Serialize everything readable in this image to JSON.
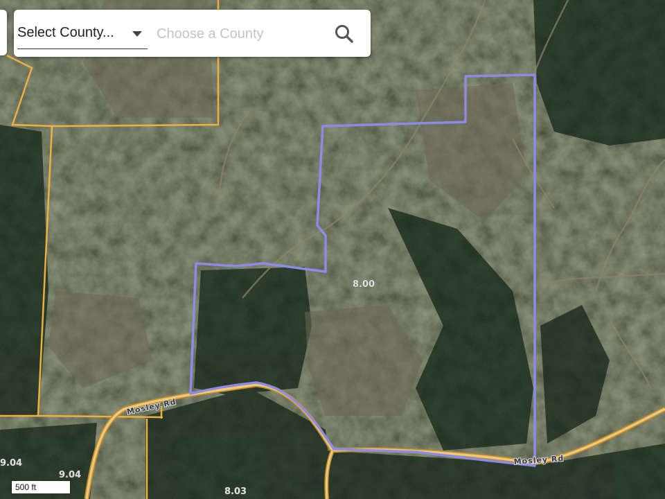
{
  "search": {
    "county_select_label": "Select County...",
    "county_placeholder": "Choose a County",
    "county_value": ""
  },
  "map": {
    "parcel_labels": [
      "8.00",
      "9.04",
      "9.04",
      "8.03"
    ],
    "road_labels": [
      "Mosley Rd",
      "Mosley Rd"
    ],
    "scale_label": "500 ft"
  },
  "colors": {
    "parcel_outline_selected": "#8c8ce6",
    "parcel_outline": "#f0b040",
    "road": "#f4c873",
    "panel_background": "#ffffff"
  },
  "icons": {
    "search": "search-icon",
    "dropdown": "chevron-down-icon"
  }
}
